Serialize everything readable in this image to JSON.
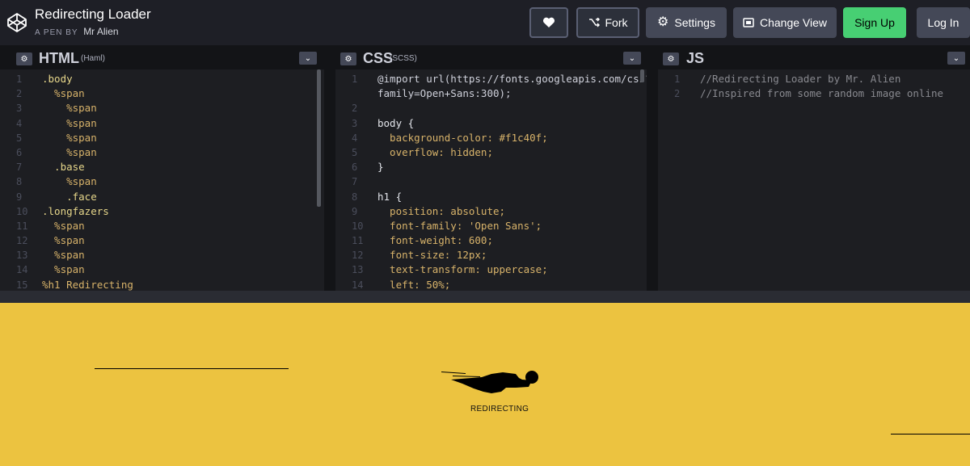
{
  "header": {
    "title": "Redirecting Loader",
    "byline_prefix": "A PEN BY",
    "author": "Mr Alien",
    "buttons": {
      "fork": "Fork",
      "settings": "Settings",
      "change_view": "Change View",
      "sign_up": "Sign Up",
      "log_in": "Log In"
    }
  },
  "colors": {
    "accent_green": "#47cf73",
    "preview_background": "#f1c40f"
  },
  "editors": {
    "html": {
      "name": "HTML",
      "preprocessor": "(Haml)",
      "lines": [
        ".body",
        "  %span",
        "    %span",
        "    %span",
        "    %span",
        "    %span",
        "  .base",
        "    %span",
        "    .face",
        ".longfazers",
        "  %span",
        "  %span",
        "  %span",
        "  %span",
        "%h1 Redirecting"
      ]
    },
    "css": {
      "name": "CSS",
      "preprocessor": "(SCSS)",
      "lines": [
        "@import url(https://fonts.googleapis.com/css?",
        "family=Open+Sans:300);",
        "",
        "body {",
        "  background-color: #f1c40f;",
        "  overflow: hidden;",
        "}",
        "",
        "h1 {",
        "  position: absolute;",
        "  font-family: 'Open Sans';",
        "  font-weight: 600;",
        "  font-size: 12px;",
        "  text-transform: uppercase;",
        "  left: 50%;"
      ],
      "line_numbers": [
        "1",
        "",
        "2",
        "3",
        "4",
        "5",
        "6",
        "7",
        "8",
        "9",
        "10",
        "11",
        "12",
        "13",
        "14"
      ]
    },
    "js": {
      "name": "JS",
      "lines": [
        "//Redirecting Loader by Mr. Alien",
        "//Inspired from some random image online"
      ]
    }
  },
  "preview": {
    "heading": "REDIRECTING"
  }
}
